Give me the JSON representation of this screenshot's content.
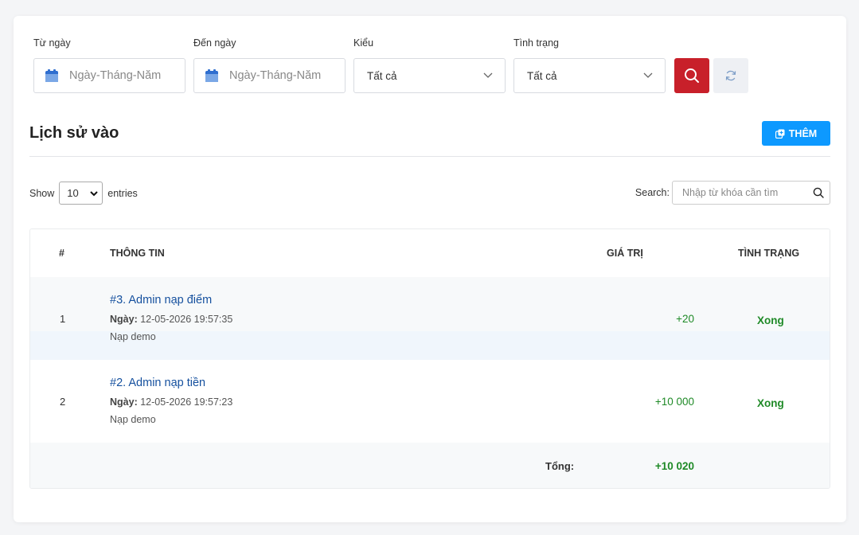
{
  "filters": {
    "from_label": "Từ ngày",
    "from_placeholder": "Ngày-Tháng-Năm",
    "to_label": "Đến ngày",
    "to_placeholder": "Ngày-Tháng-Năm",
    "type_label": "Kiểu",
    "type_value": "Tất cả",
    "status_label": "Tình trạng",
    "status_value": "Tất cả"
  },
  "section_title": "Lịch sử vào",
  "add_button": "THÊM",
  "length": {
    "show": "Show",
    "value": "10",
    "entries": "entries"
  },
  "search": {
    "label": "Search:",
    "placeholder": "Nhập từ khóa cần tìm"
  },
  "table": {
    "headers": [
      "#",
      "THÔNG TIN",
      "GIÁ TRỊ",
      "TÌNH TRẠNG"
    ],
    "rows": [
      {
        "index": "1",
        "title": "#3. Admin nạp điểm",
        "date_label": "Ngày:",
        "date": "12-05-2026 19:57:35",
        "note": "Nạp demo",
        "value": "+20",
        "status": "Xong"
      },
      {
        "index": "2",
        "title": "#2. Admin nạp tiền",
        "date_label": "Ngày:",
        "date": "12-05-2026 19:57:23",
        "note": "Nạp demo",
        "value": "+10 000",
        "status": "Xong"
      }
    ],
    "total_label": "Tổng:",
    "total_value": "+10 020"
  },
  "colors": {
    "search_button": "#c8202a",
    "add_button": "#0d99ff",
    "link": "#15509e",
    "success": "#1f8a27"
  }
}
